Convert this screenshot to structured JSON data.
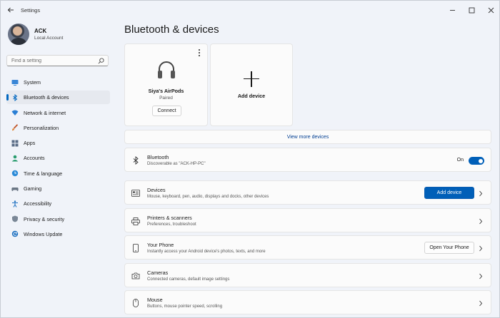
{
  "window": {
    "title": "Settings"
  },
  "profile": {
    "name": "ACK",
    "account_type": "Local Account"
  },
  "search": {
    "placeholder": "Find a setting"
  },
  "sidebar": {
    "items": [
      {
        "label": "System",
        "icon": "monitor-icon"
      },
      {
        "label": "Bluetooth & devices",
        "icon": "bluetooth-icon",
        "active": true
      },
      {
        "label": "Network & internet",
        "icon": "wifi-icon"
      },
      {
        "label": "Personalization",
        "icon": "brush-icon"
      },
      {
        "label": "Apps",
        "icon": "apps-icon"
      },
      {
        "label": "Accounts",
        "icon": "person-icon"
      },
      {
        "label": "Time & language",
        "icon": "globe-clock-icon"
      },
      {
        "label": "Gaming",
        "icon": "gamepad-icon"
      },
      {
        "label": "Accessibility",
        "icon": "accessibility-icon"
      },
      {
        "label": "Privacy & security",
        "icon": "shield-icon"
      },
      {
        "label": "Windows Update",
        "icon": "update-icon"
      }
    ]
  },
  "page": {
    "title": "Bluetooth & devices"
  },
  "device_card": {
    "name": "Siya's AirPods",
    "status": "Paired",
    "connect_label": "Connect",
    "icon": "headphones-icon"
  },
  "add_card": {
    "label": "Add device"
  },
  "view_more": {
    "label": "View more devices"
  },
  "rows": {
    "bluetooth": {
      "title": "Bluetooth",
      "subtitle": "Discoverable as \"ACK-HP-PC\"",
      "toggle_label": "On",
      "toggle_on": true
    },
    "devices": {
      "title": "Devices",
      "subtitle": "Mouse, keyboard, pen, audio, displays and docks, other devices",
      "button_label": "Add device"
    },
    "printers": {
      "title": "Printers & scanners",
      "subtitle": "Preferences, troubleshoot"
    },
    "phone": {
      "title": "Your Phone",
      "subtitle": "Instantly access your Android device's photos, texts, and more",
      "button_label": "Open Your Phone"
    },
    "cameras": {
      "title": "Cameras",
      "subtitle": "Connected cameras, default image settings"
    },
    "mouse": {
      "title": "Mouse",
      "subtitle": "Buttons, mouse pointer speed, scrolling"
    }
  },
  "colors": {
    "accent": "#005fb8",
    "background": "#f0f3f9",
    "card": "#fbfbfb"
  }
}
